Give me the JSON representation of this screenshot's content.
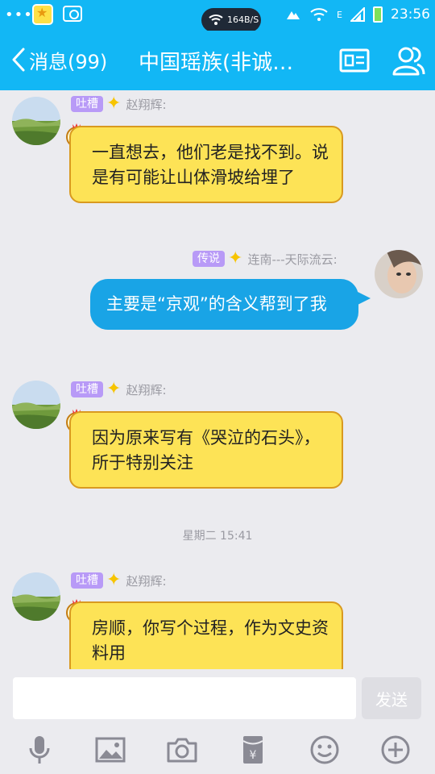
{
  "statusbar": {
    "dots": "•••",
    "net_speed": "164B/S",
    "net_type": "E",
    "time": "23:56"
  },
  "header": {
    "back_label": "消息(99)",
    "title": "中国瑶族(非诚…"
  },
  "messages": [
    {
      "badge": "吐槽",
      "sender": "赵翔辉:",
      "text": "一直想去，他们老是找不到。说是有可能让山体滑坡给埋了"
    },
    {
      "badge": "传说",
      "sender": "连南---天际流云:",
      "text": "主要是“京观”的含义帮到了我"
    },
    {
      "badge": "吐槽",
      "sender": "赵翔辉:",
      "text": "因为原来写有《哭泣的石头》，所于特别关注"
    },
    {
      "badge": "吐槽",
      "sender": "赵翔辉:",
      "text": "房顺，你写个过程，作为文史资料用"
    }
  ],
  "timestamp": "星期二 15:41",
  "composer": {
    "send_label": "发送",
    "input_value": ""
  },
  "toolbar": {
    "icons": [
      "microphone-icon",
      "image-icon",
      "camera-icon",
      "red-packet-icon",
      "emoji-icon",
      "plus-icon"
    ]
  },
  "colors": {
    "accent": "#12b7f5",
    "own_bubble": "#19a4e6",
    "other_bubble": "#fde356",
    "badge": "#b89af7"
  }
}
